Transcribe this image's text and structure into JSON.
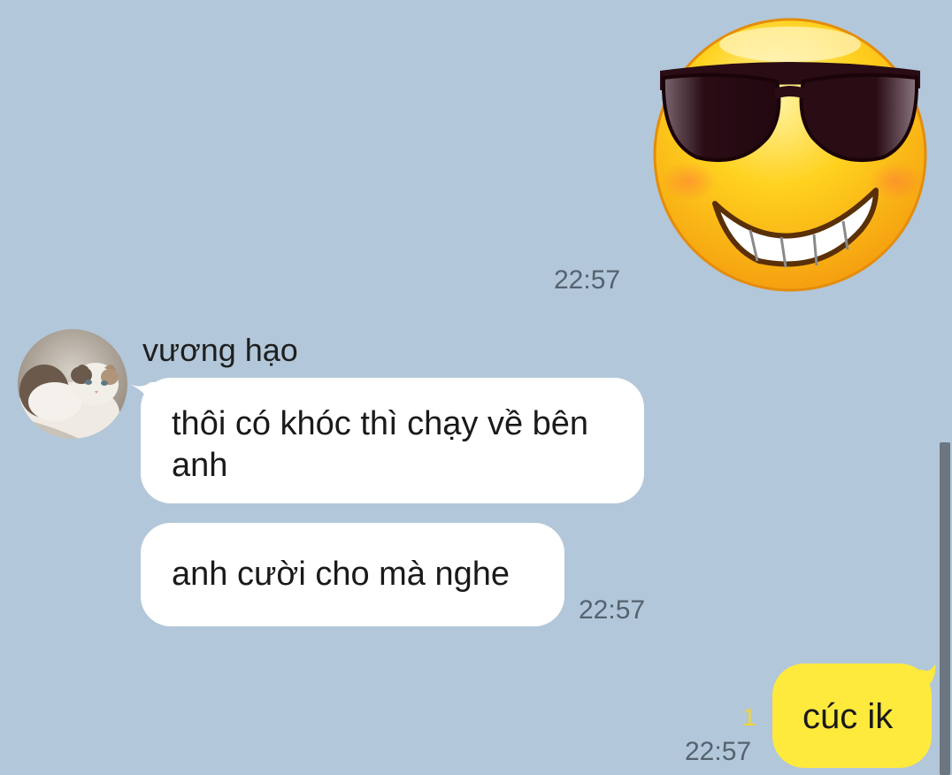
{
  "chat": {
    "sticker_message": {
      "sticker": "cool-sunglasses-smiley-icon",
      "time": "22:57"
    },
    "incoming": {
      "sender_name": "vương hạo",
      "avatar": "cat-avatar",
      "messages": [
        "thôi có khóc thì chạy về bên anh",
        "anh cười cho mà nghe"
      ],
      "time": "22:57"
    },
    "outgoing": {
      "text": "cúc ik",
      "unread_count": "1",
      "time": "22:57"
    }
  },
  "colors": {
    "background": "#b2c7d9",
    "incoming_bubble": "#ffffff",
    "outgoing_bubble": "#fee93d",
    "unread_count": "#f3d535",
    "timestamp": "#556270"
  }
}
